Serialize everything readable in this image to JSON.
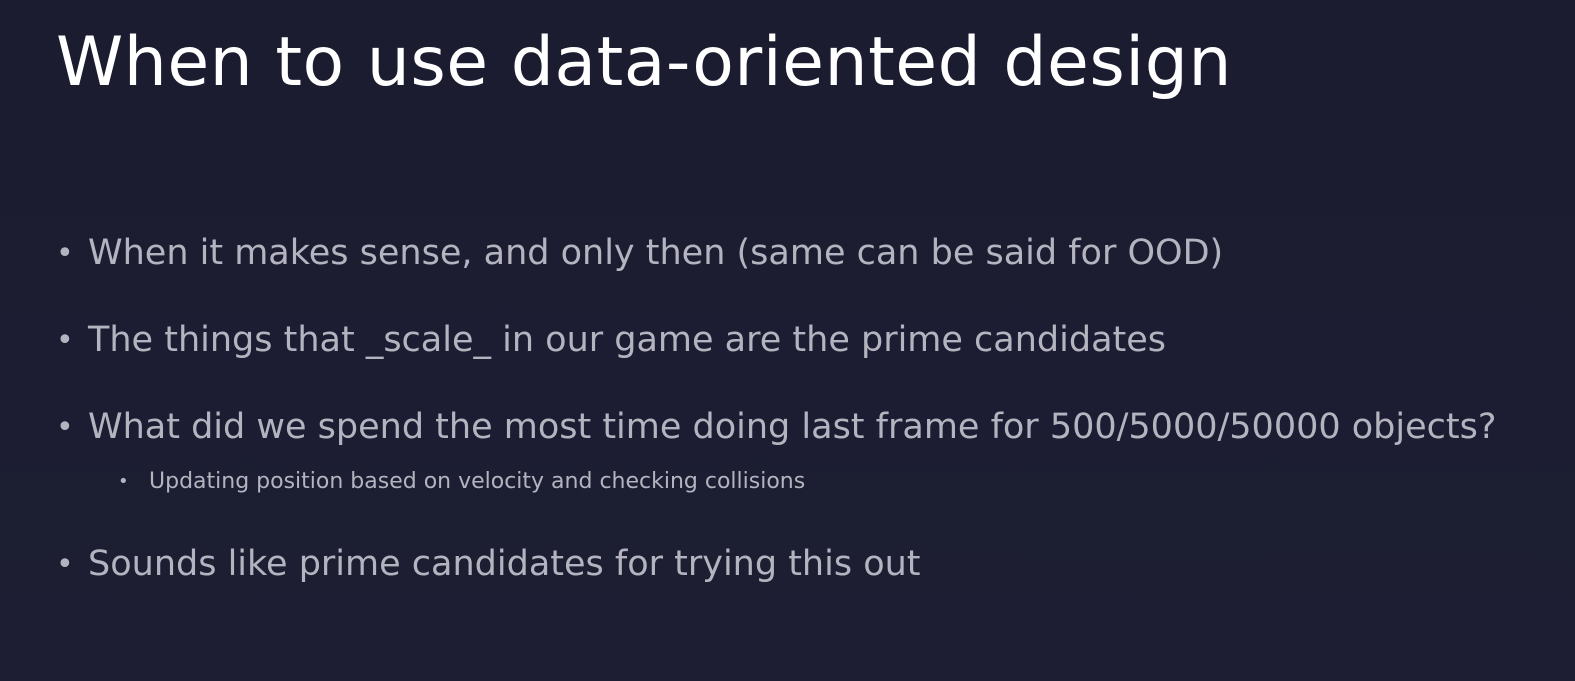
{
  "slide": {
    "title": "When to use data-oriented design",
    "bullets": [
      "When it makes sense, and only then (same can be said for OOD)",
      "The things that _scale_ in our game are the prime candidates",
      "What did we spend the most time doing last frame for 500/5000/50000 objects?",
      "Sounds like prime candidates for trying this out"
    ],
    "sub_bullets": [
      "Updating position based on velocity and checking collisions"
    ],
    "colors": {
      "background": "#1c1d31",
      "title": "#ffffff",
      "body_text": "#b4b4c0"
    }
  }
}
